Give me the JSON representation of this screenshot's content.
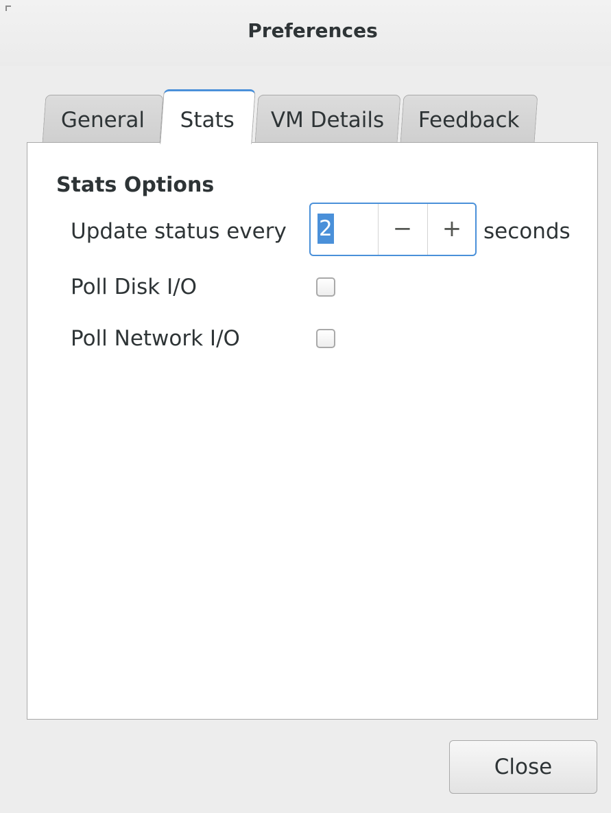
{
  "window": {
    "title": "Preferences"
  },
  "tabs": [
    {
      "label": "General"
    },
    {
      "label": "Stats"
    },
    {
      "label": "VM Details"
    },
    {
      "label": "Feedback"
    }
  ],
  "active_tab": "Stats",
  "stats": {
    "section_title": "Stats Options",
    "update": {
      "label": "Update status every",
      "value": "2",
      "minus": "−",
      "plus": "+",
      "suffix": "seconds"
    },
    "poll_disk": {
      "label": "Poll Disk I/O",
      "checked": false
    },
    "poll_network": {
      "label": "Poll Network I/O",
      "checked": false
    }
  },
  "footer": {
    "close_label": "Close"
  },
  "colors": {
    "accent": "#4a90d9",
    "window_bg": "#ededed",
    "page_bg": "#ffffff"
  }
}
